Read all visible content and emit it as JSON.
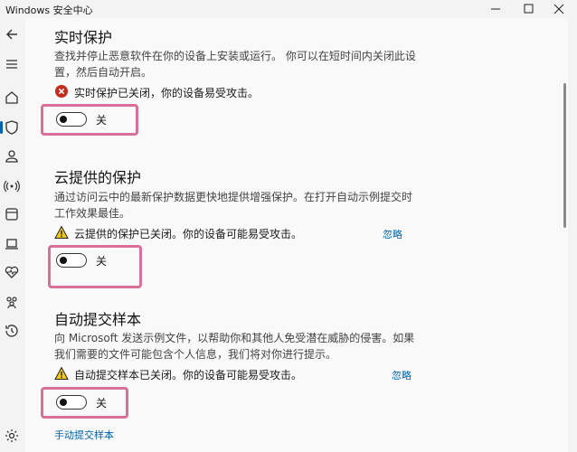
{
  "window": {
    "title": "Windows 安全中心",
    "minimize_icon": "minimize-icon",
    "maximize_icon": "maximize-icon",
    "close_icon": "close-icon"
  },
  "sidebar": {
    "items": [
      {
        "icon": "back-arrow-icon"
      },
      {
        "icon": "hamburger-menu-icon"
      },
      {
        "icon": "home-icon"
      },
      {
        "icon": "shield-icon",
        "active": true
      },
      {
        "icon": "person-icon"
      },
      {
        "icon": "wifi-antenna-icon"
      },
      {
        "icon": "app-browser-icon"
      },
      {
        "icon": "laptop-icon"
      },
      {
        "icon": "heart-pulse-icon"
      },
      {
        "icon": "family-icon"
      },
      {
        "icon": "history-icon"
      },
      {
        "icon": "settings-gear-icon"
      }
    ]
  },
  "sections": {
    "realtime": {
      "title": "实时保护",
      "desc": "查找并停止恶意软件在你的设备上安装或运行。 你可以在短时间内关闭此设置，然后自动开启。",
      "status": "实时保护已关闭，你的设备易受攻击。",
      "status_icon": "error-circle-icon",
      "toggle_label": "关"
    },
    "cloud": {
      "title": "云提供的保护",
      "desc": "通过访问云中的最新保护数据更快地提供增强保护。在打开自动示例提交时工作效果最佳。",
      "status": "云提供的保护已关闭。你的设备可能易受攻击。",
      "status_icon": "warning-triangle-icon",
      "ignore": "忽略",
      "toggle_label": "关"
    },
    "autosubmit": {
      "title": "自动提交样本",
      "desc": "向 Microsoft 发送示例文件，以帮助你和其他人免受潜在威胁的侵害。如果我们需要的文件可能包含个人信息，我们将对你进行提示。",
      "status": "自动提交样本已关闭。你的设备可能易受攻击。",
      "status_icon": "warning-triangle-icon",
      "ignore": "忽略",
      "toggle_label": "关",
      "manual_link": "手动提交样本"
    }
  },
  "colors": {
    "accent": "#0063b1",
    "highlight": "#d9709a",
    "error": "#c42b1c",
    "warning": "#f2c811",
    "link": "#0062ad"
  }
}
